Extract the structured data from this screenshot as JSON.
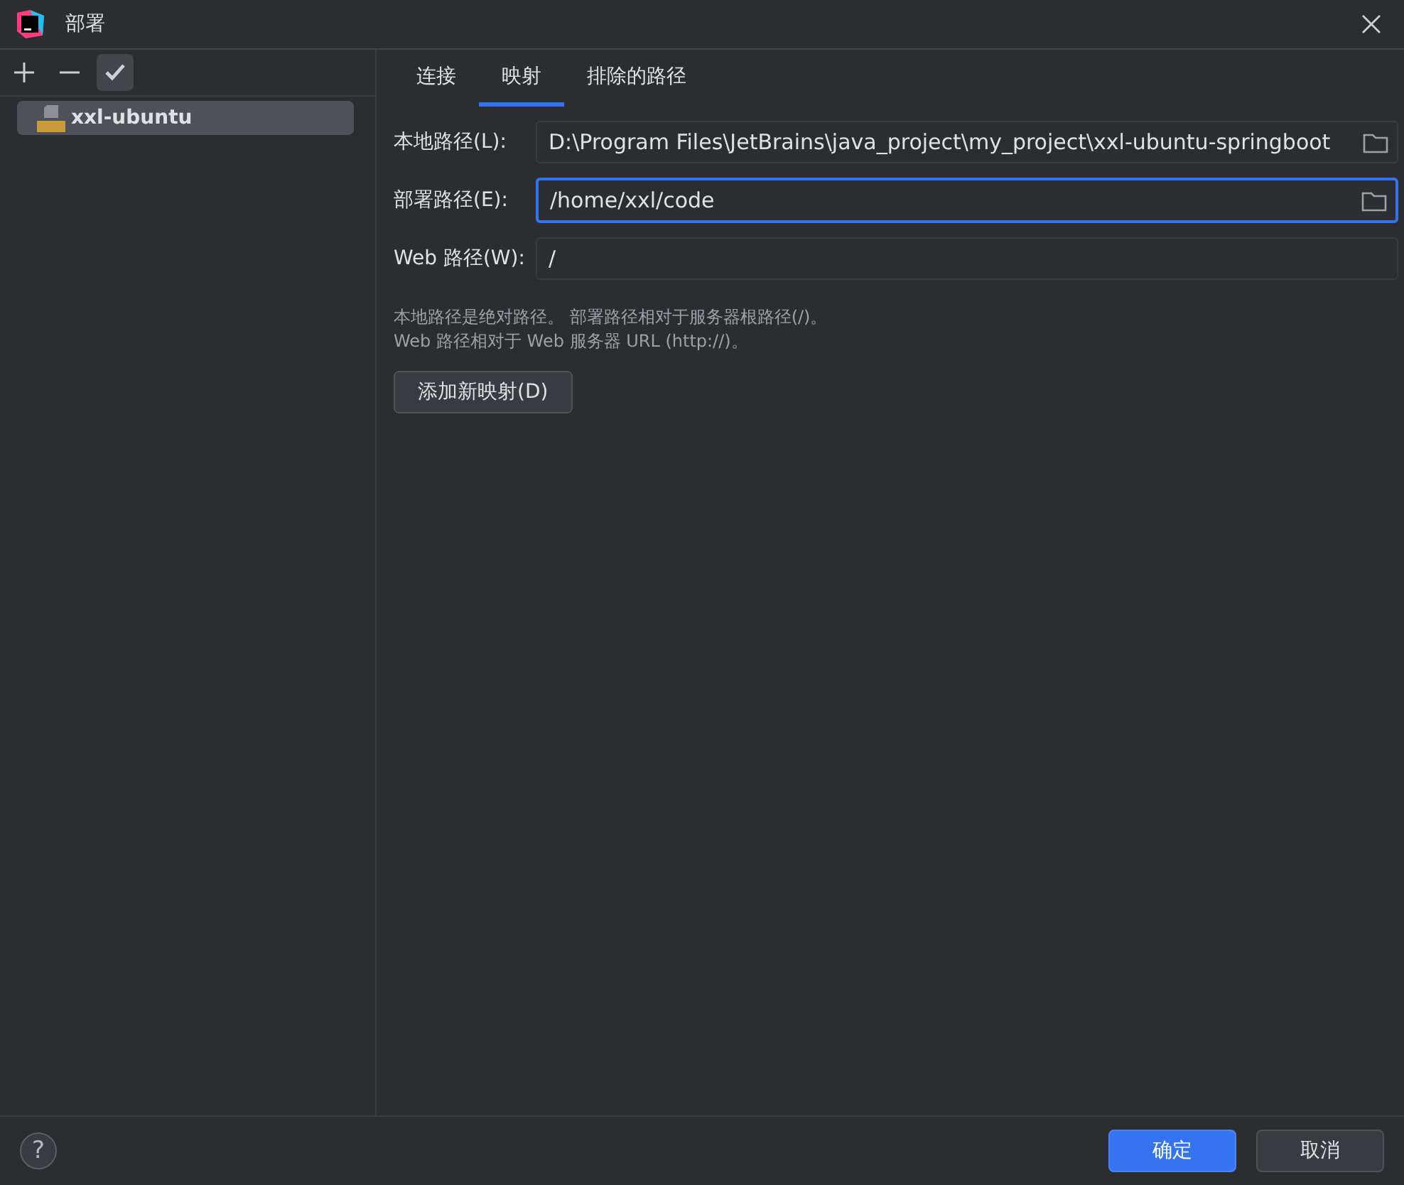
{
  "window": {
    "title": "部署"
  },
  "sidebar": {
    "items": [
      {
        "label": "xxl-ubuntu",
        "selected": true
      }
    ]
  },
  "tabs": [
    {
      "label": "连接",
      "selected": false
    },
    {
      "label": "映射",
      "selected": true
    },
    {
      "label": "排除的路径",
      "selected": false
    }
  ],
  "fields": [
    {
      "label": "本地路径(L):",
      "value": "D:\\Program Files\\JetBrains\\java_project\\my_project\\xxl-ubuntu-springboot",
      "browse": true,
      "focused": false
    },
    {
      "label": "部署路径(E):",
      "value": "/home/xxl/code",
      "browse": true,
      "focused": true
    },
    {
      "label": "Web 路径(W):",
      "value": "/",
      "browse": false,
      "focused": false
    }
  ],
  "hints": [
    "本地路径是绝对路径。 部署路径相对于服务器根路径(/)。",
    "Web 路径相对于 Web 服务器 URL (http://)。"
  ],
  "add_button": "添加新映射(D)",
  "help": "?",
  "buttons": [
    {
      "label": "确定",
      "kind": "primary"
    },
    {
      "label": "取消",
      "kind": "secondary"
    }
  ]
}
